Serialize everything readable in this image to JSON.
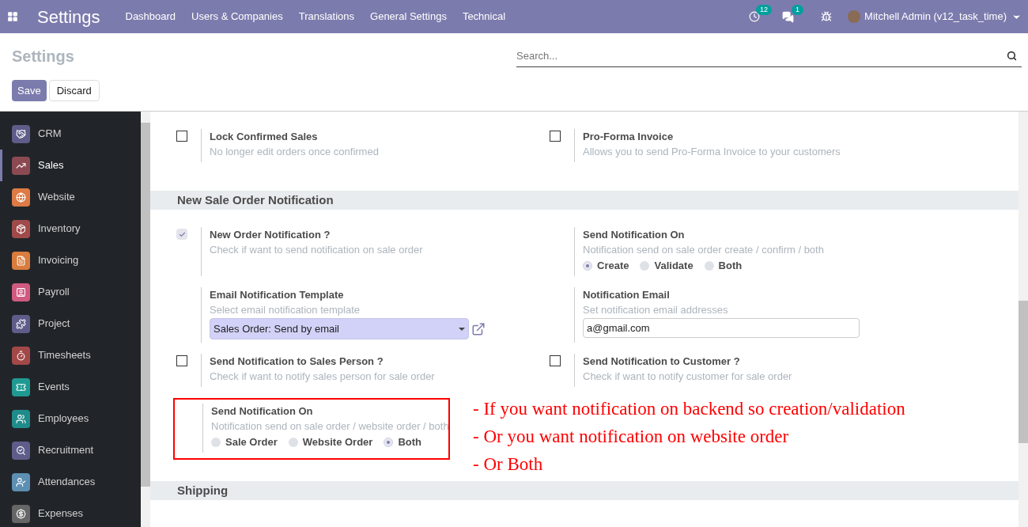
{
  "navbar": {
    "title": "Settings",
    "menu": [
      "Dashboard",
      "Users & Companies",
      "Translations",
      "General Settings",
      "Technical"
    ],
    "activity_count": "12",
    "message_count": "1",
    "user": "Mitchell Admin (v12_task_time)"
  },
  "control_panel": {
    "breadcrumb": "Settings",
    "search": {
      "placeholder": "Search..."
    },
    "buttons": [
      {
        "label": "Save",
        "kind": "primary"
      },
      {
        "label": "Discard",
        "kind": "secondary"
      }
    ]
  },
  "sidebar": {
    "items": [
      {
        "label": "CRM",
        "color": "#5e5d8a",
        "selected": false
      },
      {
        "label": "Sales",
        "color": "#8b4a52",
        "selected": true
      },
      {
        "label": "Website",
        "color": "#dd7a45",
        "selected": false
      },
      {
        "label": "Inventory",
        "color": "#a04a4a",
        "selected": false
      },
      {
        "label": "Invoicing",
        "color": "#d97c3e",
        "selected": false
      },
      {
        "label": "Payroll",
        "color": "#d05a80",
        "selected": false
      },
      {
        "label": "Project",
        "color": "#5e5d8a",
        "selected": false
      },
      {
        "label": "Timesheets",
        "color": "#a34848",
        "selected": false
      },
      {
        "label": "Events",
        "color": "#1f9a92",
        "selected": false
      },
      {
        "label": "Employees",
        "color": "#208b8b",
        "selected": false
      },
      {
        "label": "Recruitment",
        "color": "#5e5d8a",
        "selected": false
      },
      {
        "label": "Attendances",
        "color": "#5d8fb3",
        "selected": false
      },
      {
        "label": "Expenses",
        "color": "#666666",
        "selected": false
      }
    ]
  },
  "top_items": [
    {
      "kind": "checkbox",
      "title": "Lock Confirmed Sales",
      "description": "No longer edit orders once confirmed",
      "checked": false
    },
    {
      "kind": "checkbox",
      "title": "Pro-Forma Invoice",
      "description": "Allows you to send Pro-Forma Invoice to your customers",
      "checked": false
    }
  ],
  "sections": [
    {
      "title": "New Sale Order Notification",
      "items": [
        {
          "kind": "checkbox",
          "title": "New Order Notification ?",
          "description": "Check if want to send notification on sale order",
          "checked": true
        },
        {
          "kind": "radio",
          "title": "Send Notification On",
          "description": "Notification send on sale order create / confirm / both",
          "options": [
            {
              "label": "Create",
              "selected": true
            },
            {
              "label": "Validate",
              "selected": false
            },
            {
              "label": "Both",
              "selected": false
            }
          ]
        },
        {
          "kind": "select",
          "title": "Email Notification Template",
          "description": "Select email notification template",
          "value": "Sales Order: Send by email"
        },
        {
          "kind": "input",
          "title": "Notification Email",
          "description": "Set notification email addresses",
          "value": "a@gmail.com"
        },
        {
          "kind": "checkbox",
          "title": "Send Notification to Sales Person ?",
          "description": "Check if want to notify sales person for sale order",
          "checked": false
        },
        {
          "kind": "checkbox",
          "title": "Send Notification to Customer ?",
          "description": "Check if want to notify customer for sale order",
          "checked": false
        },
        {
          "kind": "radio",
          "title": "Send Notification On",
          "description": "Notification send on sale order / website order / both",
          "highlighted": true,
          "options": [
            {
              "label": "Sale Order",
              "selected": false
            },
            {
              "label": "Website Order",
              "selected": false
            },
            {
              "label": "Both",
              "selected": true
            }
          ]
        }
      ],
      "annotation": [
        "- If you want notification on backend so creation/validation",
        "- Or you want notification on website order",
        "- Or Both"
      ]
    },
    {
      "title": "Shipping"
    }
  ]
}
